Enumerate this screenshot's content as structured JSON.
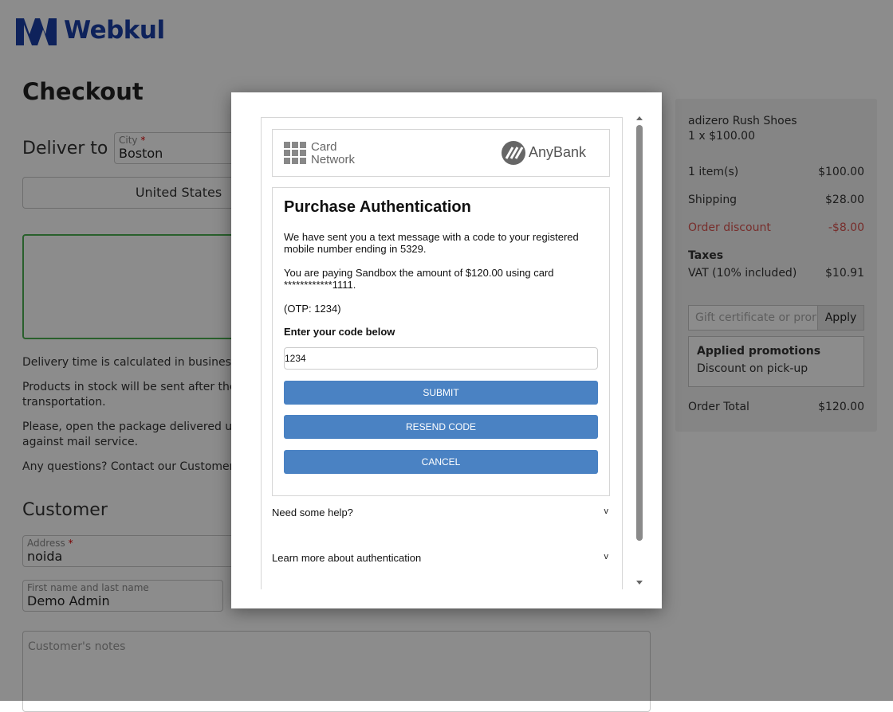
{
  "logo": {
    "text": "Webkul",
    "color": "#1a3fa6"
  },
  "page": {
    "title": "Checkout"
  },
  "delivery": {
    "label": "Deliver to",
    "city_label": "City",
    "city_value": "Boston",
    "country": "United States",
    "info": [
      "Delivery time is calculated in business da",
      "Products in stock will be sent after the pa",
      "transportation.",
      "Please, open the package delivered unde",
      "against mail service.",
      "Any questions? Contact our Customer Se"
    ]
  },
  "customer": {
    "title": "Customer",
    "address_label": "Address",
    "address_value": "noida",
    "name_label": "First name and last name",
    "name_value": "Demo Admin",
    "notes_placeholder": "Customer's notes"
  },
  "summary": {
    "product_name": "adizero Rush Shoes",
    "product_qty": "1 x $100.00",
    "rows": [
      {
        "label": "1 item(s)",
        "value": "$100.00"
      },
      {
        "label": "Shipping",
        "value": "$28.00"
      },
      {
        "label": "Order discount",
        "value": "-$8.00"
      }
    ],
    "taxes_label": "Taxes",
    "vat_label": "VAT (10% included)",
    "vat_value": "$10.91",
    "promo_placeholder": "Gift certificate or promo",
    "apply_label": "Apply",
    "applied_title": "Applied promotions",
    "applied_item": "Discount on pick-up",
    "total_label": "Order Total",
    "total_value": "$120.00",
    "discount_color": "#d9534f"
  },
  "modal": {
    "card_network_line1": "Card",
    "card_network_line2": "Network",
    "bank_name": "AnyBank",
    "title": "Purchase Authentication",
    "sent_message": "We have sent you a text message with a code to your registered mobile number ending in 5329.",
    "paying_message": "You are paying Sandbox the amount of $120.00 using card ************1111.",
    "otp_hint": "(OTP: 1234)",
    "code_label": "Enter your code below",
    "code_value": "1234",
    "submit_label": "SUBMIT",
    "resend_label": "RESEND CODE",
    "cancel_label": "CANCEL",
    "help_label": "Need some help?",
    "learn_label": "Learn more about authentication",
    "chevron": "v",
    "button_color": "#4a82c3"
  }
}
